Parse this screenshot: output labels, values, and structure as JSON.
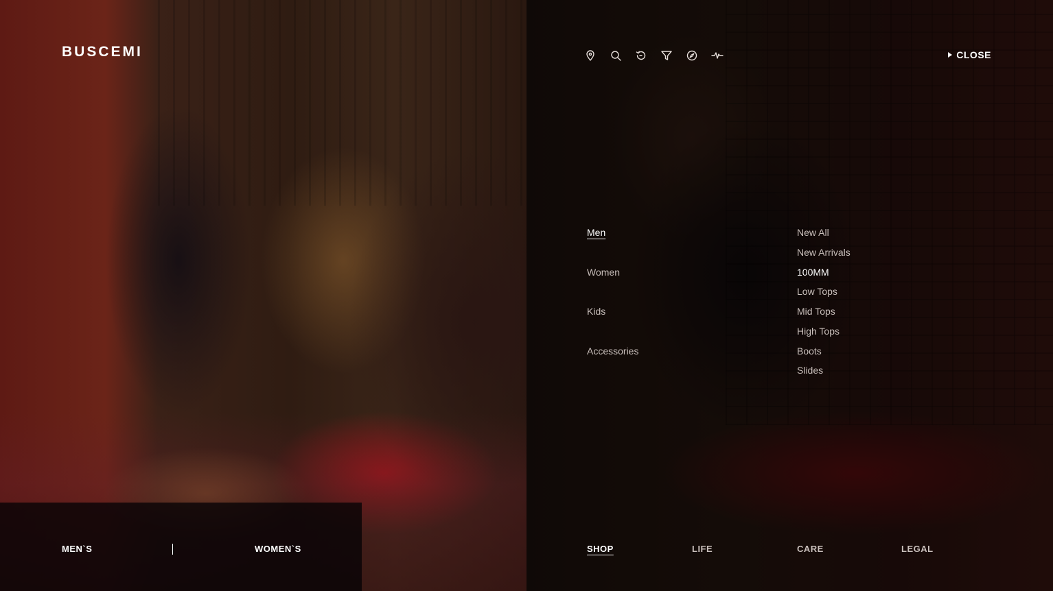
{
  "brand": {
    "logo": "BUSCEMI"
  },
  "toolbar": {
    "icons": [
      "location-pin-icon",
      "search-icon",
      "history-icon",
      "filter-icon",
      "compass-icon",
      "activity-pulse-icon"
    ],
    "close_label": "CLOSE"
  },
  "shop_menu": {
    "categories": [
      "Men",
      "Women",
      "Kids",
      "Accessories"
    ],
    "active_category": "Men",
    "subcategories": [
      "New All",
      "New Arrivals",
      "100MM",
      "Low Tops",
      "Mid Tops",
      "High Tops",
      "Boots",
      "Slides"
    ],
    "active_subcategory": "100MM"
  },
  "gender_switch": {
    "mens": "MEN`S",
    "womens": "WOMEN`S"
  },
  "footer_nav": {
    "items": [
      "SHOP",
      "LIFE",
      "CARE",
      "LEGAL"
    ],
    "active": "SHOP"
  },
  "colors": {
    "text_active": "#ffffff",
    "text_muted": "#c9bfbb",
    "accent_red": "#8b1014"
  }
}
